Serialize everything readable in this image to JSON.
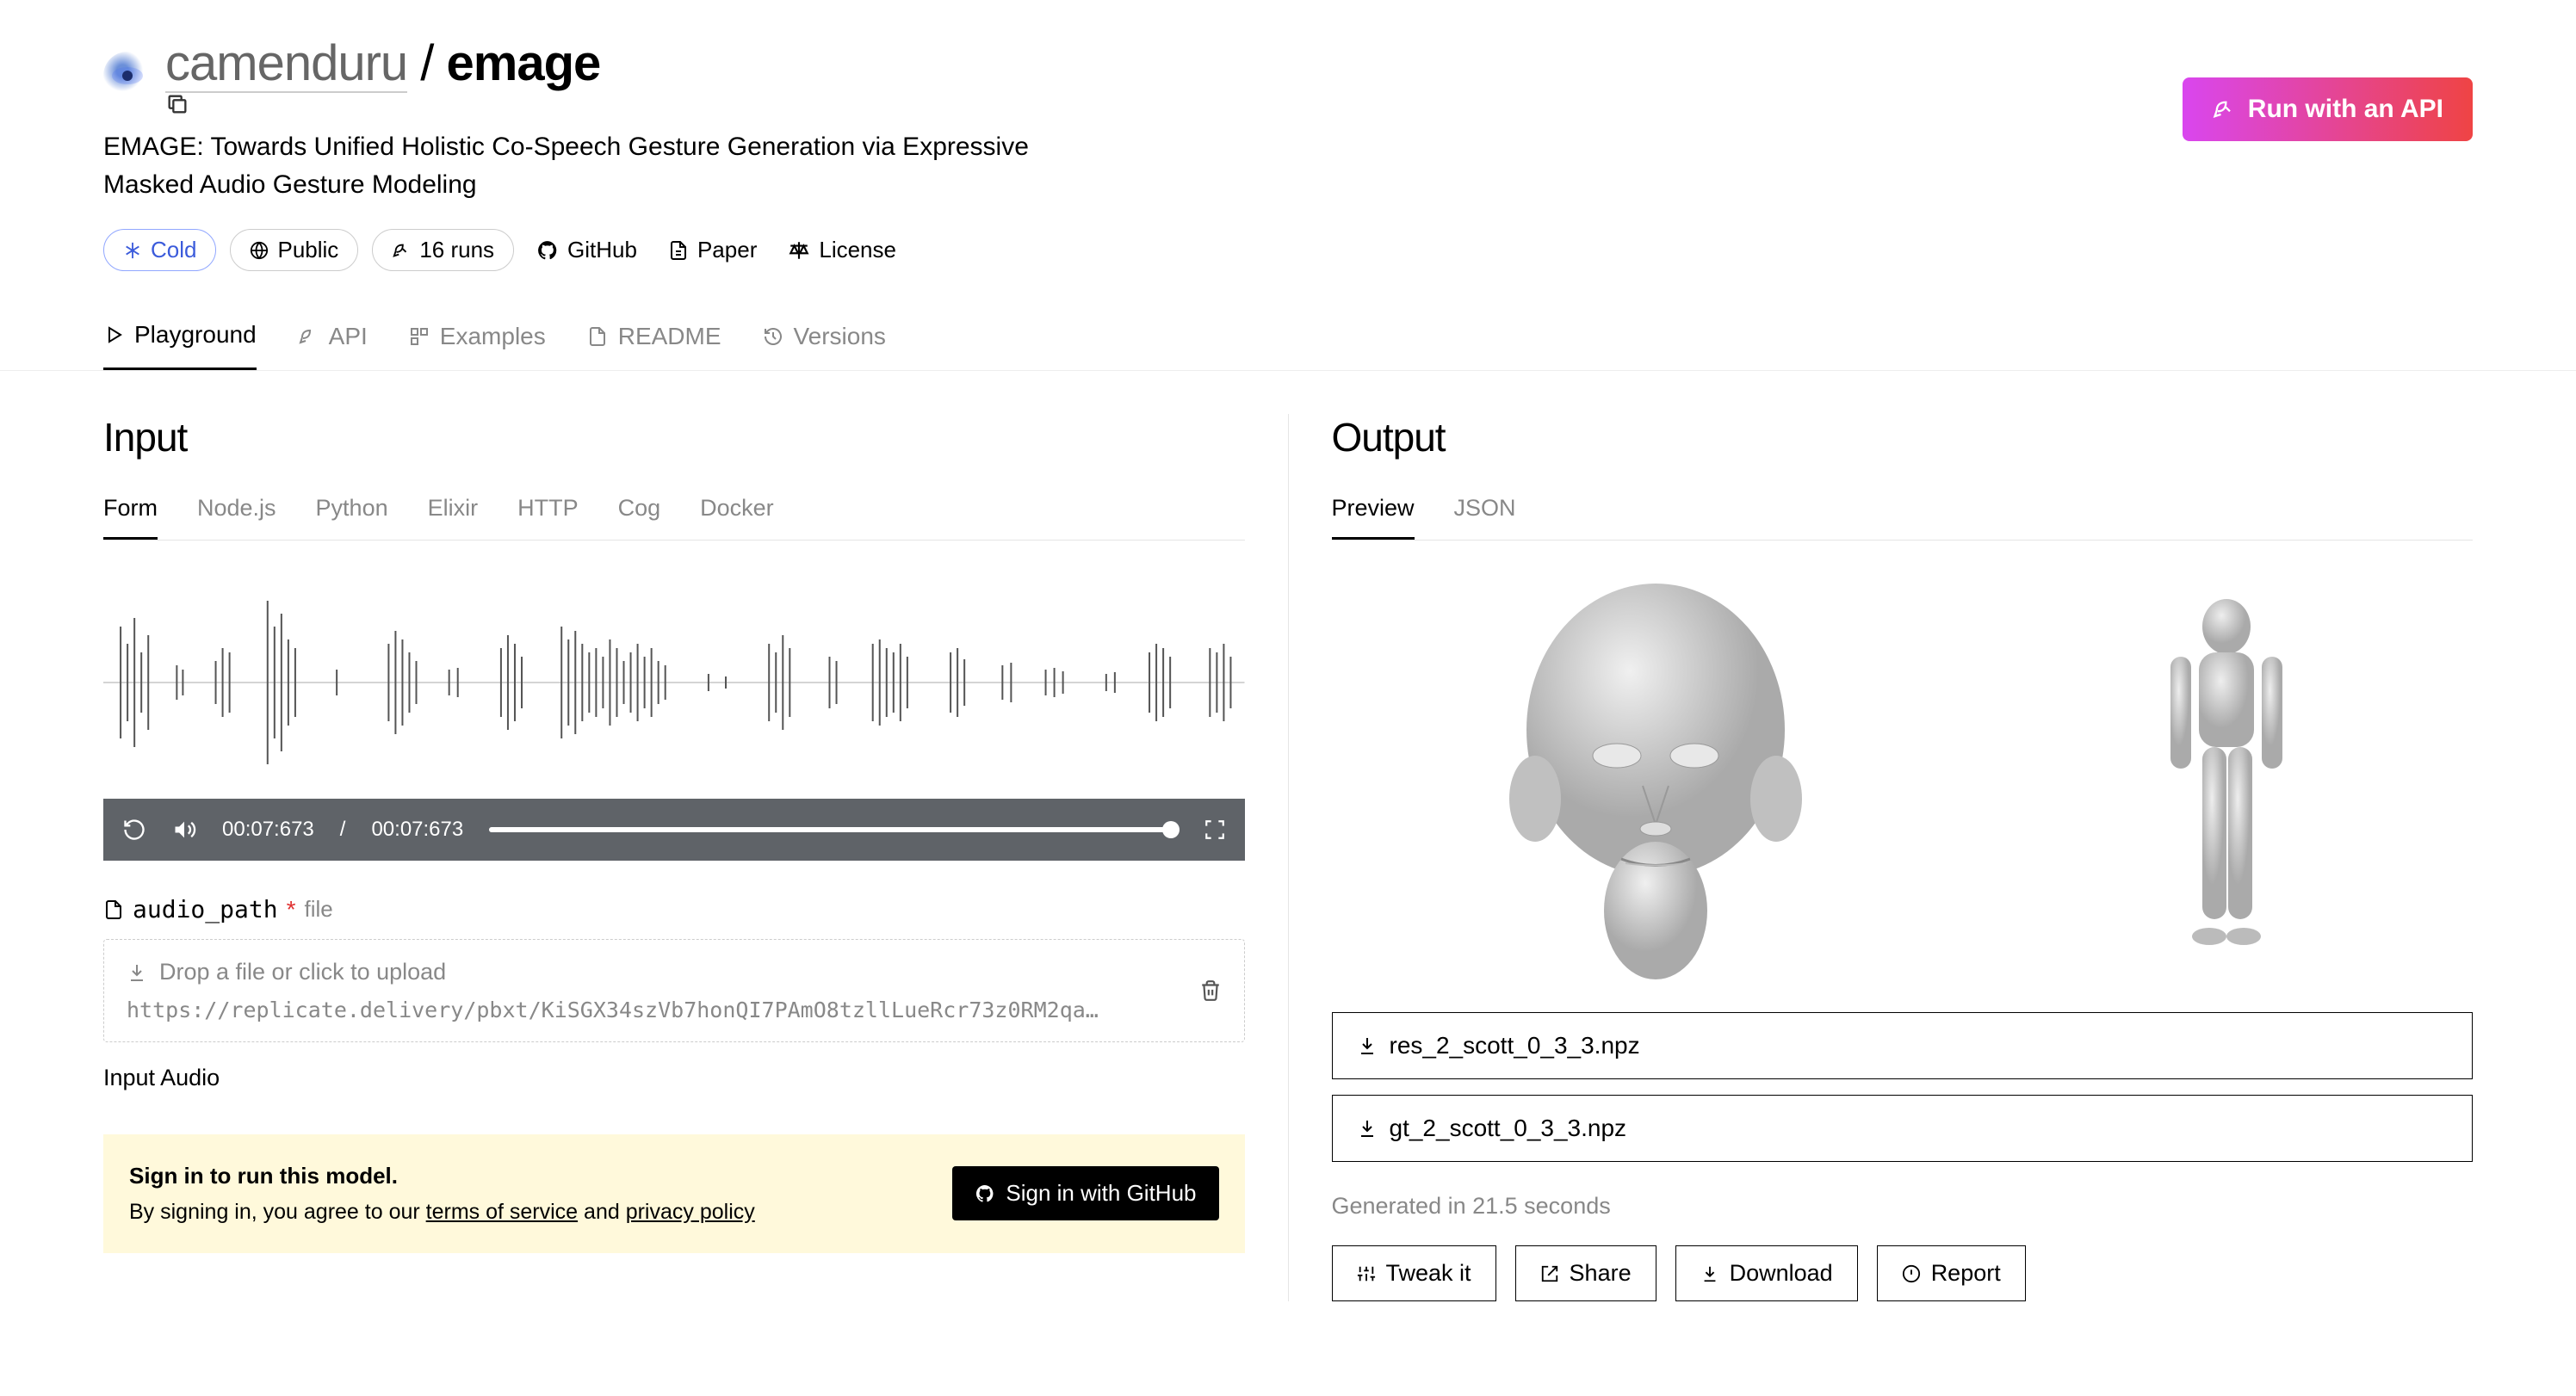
{
  "header": {
    "owner": "camenduru",
    "separator": " / ",
    "model": "emage",
    "description": "EMAGE: Towards Unified Holistic Co-Speech Gesture Generation via Expressive Masked Audio Gesture Modeling",
    "run_api": "Run with an API"
  },
  "badges": {
    "cold": "Cold",
    "public": "Public",
    "runs": "16 runs",
    "github": "GitHub",
    "paper": "Paper",
    "license": "License"
  },
  "tabs": [
    "Playground",
    "API",
    "Examples",
    "README",
    "Versions"
  ],
  "input": {
    "title": "Input",
    "subtabs": [
      "Form",
      "Node.js",
      "Python",
      "Elixir",
      "HTTP",
      "Cog",
      "Docker"
    ],
    "time_current": "00:07:673",
    "time_sep": "/",
    "time_total": "00:07:673",
    "param_name": "audio_path",
    "param_req": "*",
    "param_type": "file",
    "drop_hint": "Drop a file or click to upload",
    "drop_url": "https://replicate.delivery/pbxt/KiSGX34szVb7honQI7PAmO8tzllLueRcr73z0RM2qaV6C2Z...",
    "help": "Input Audio"
  },
  "signin": {
    "title": "Sign in to run this model.",
    "prefix": "By signing in, you agree to our ",
    "tos": "terms of service",
    "and": " and ",
    "privacy": "privacy policy",
    "button": "Sign in with GitHub"
  },
  "output": {
    "title": "Output",
    "subtabs": [
      "Preview",
      "JSON"
    ],
    "files": [
      "res_2_scott_0_3_3.npz",
      "gt_2_scott_0_3_3.npz"
    ],
    "gen_time": "Generated in 21.5 seconds",
    "actions": [
      "Tweak it",
      "Share",
      "Download",
      "Report"
    ]
  }
}
